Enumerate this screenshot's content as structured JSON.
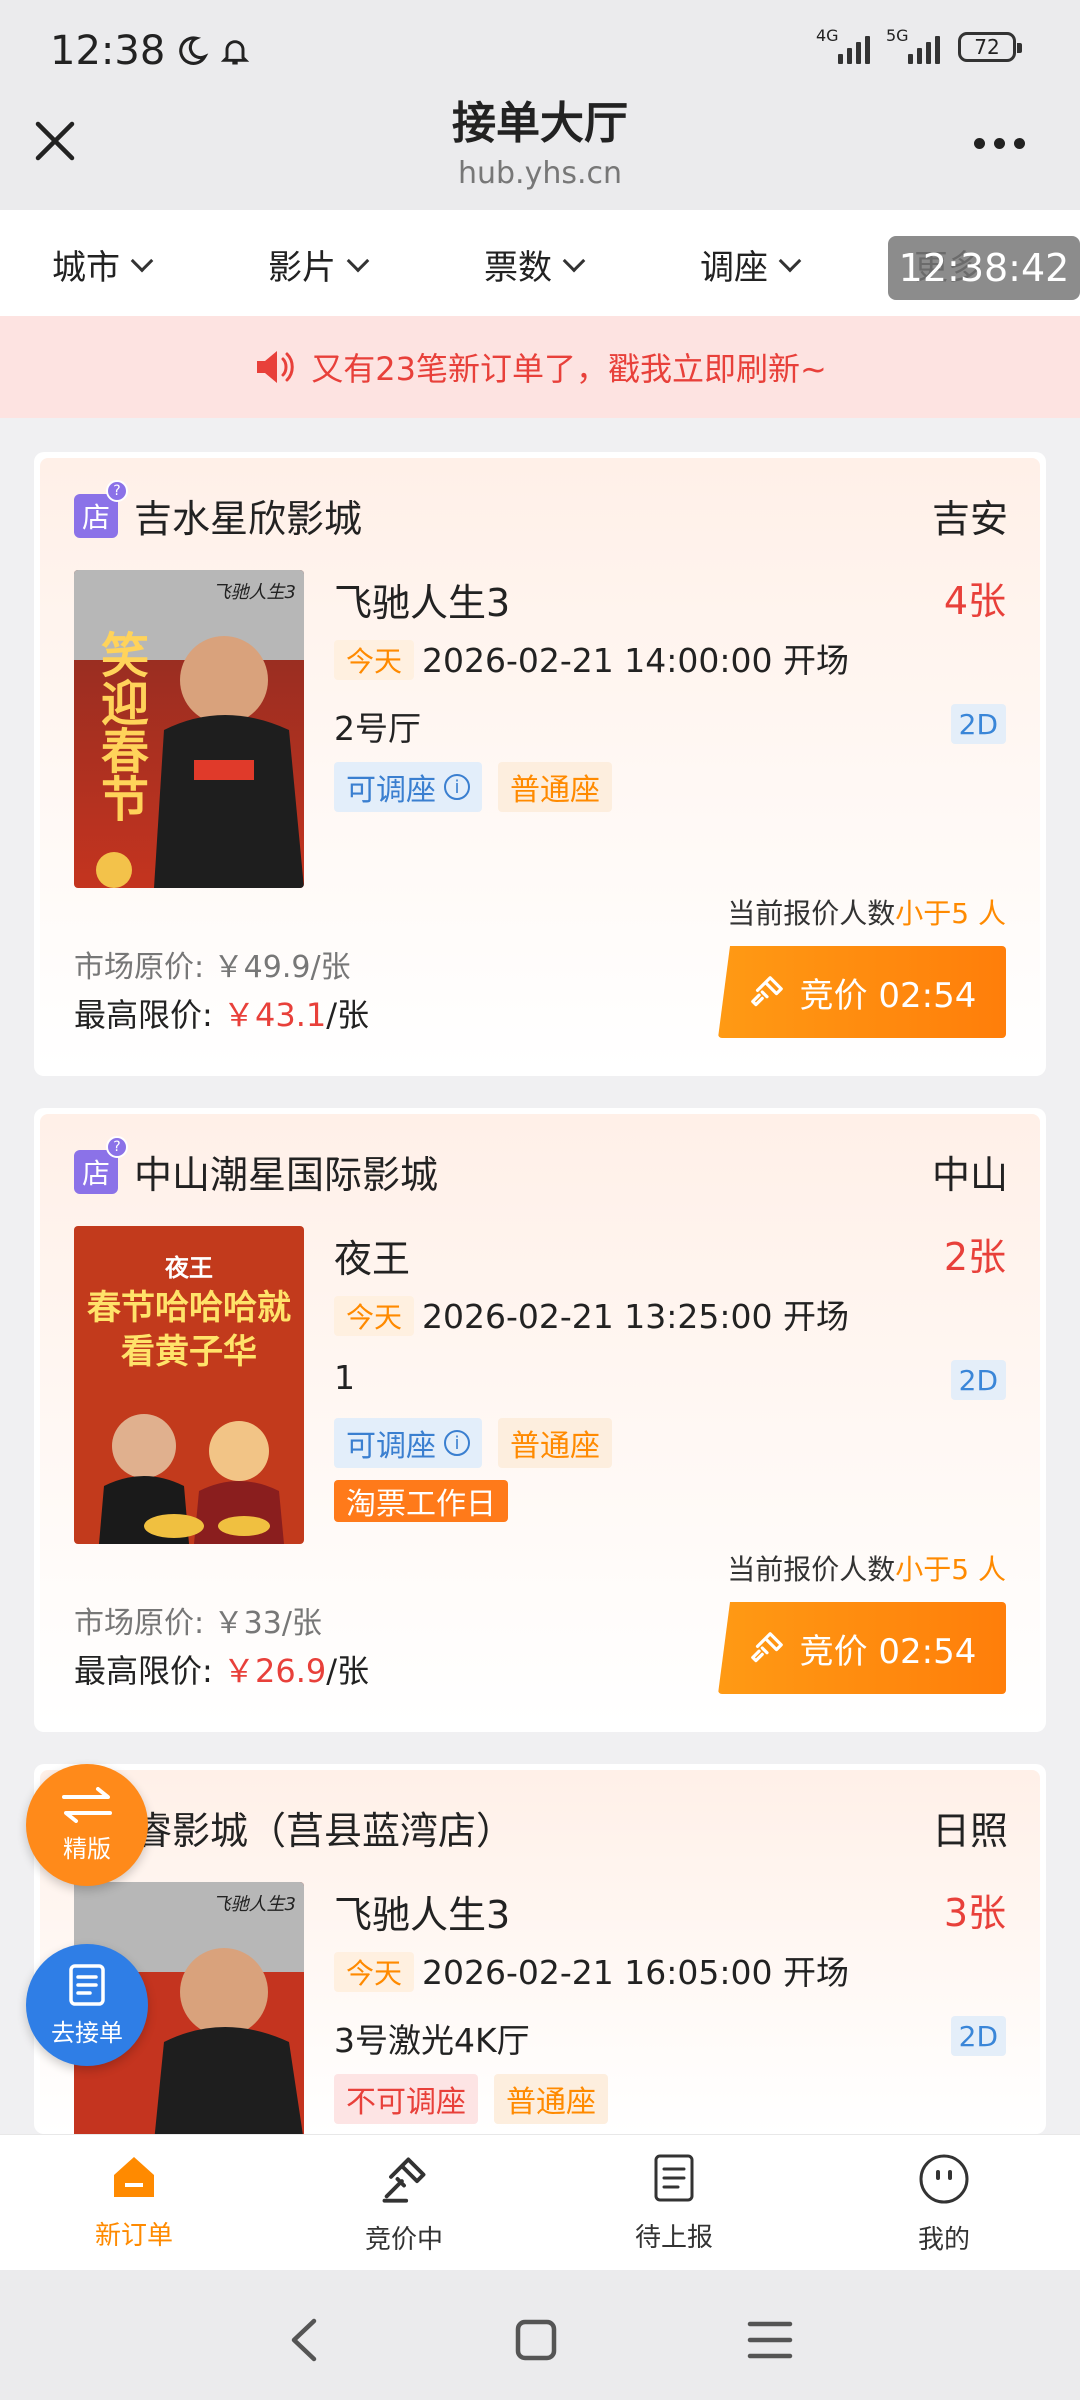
{
  "status_bar": {
    "time": "12:38",
    "net1": "4G",
    "net2": "5G",
    "battery": "72"
  },
  "header": {
    "title": "接单大厅",
    "subtitle": "hub.yhs.cn"
  },
  "filters": {
    "city": "城市",
    "movie": "影片",
    "tickets": "票数",
    "seat": "调座",
    "more": "更多"
  },
  "time_overlay": "12:38:42",
  "notice": "又有23笔新订单了，戳我立即刷新~",
  "orders": [
    {
      "store_badge": "店",
      "cinema": "吉水星欣影城",
      "city": "吉安",
      "poster_text": "笑迎春节",
      "poster_logo": "飞驰人生3",
      "movie": "飞驰人生3",
      "qty": "4张",
      "today": "今天",
      "showtime": "2026-02-21 14:00:00 开场",
      "hall": "2号厅",
      "format": "2D",
      "tags": [
        "可调座",
        "普通座"
      ],
      "bid_count_label": "当前报价人数",
      "bid_count_value": "小于5 人",
      "bid_button": "竞价 02:54",
      "market_price": "市场原价: ￥49.9/张",
      "max_price_label": "最高限价:",
      "max_price": "￥43.1",
      "max_price_unit": "/张"
    },
    {
      "store_badge": "店",
      "cinema": "中山潮星国际影城",
      "city": "中山",
      "poster_text": "春节哈哈哈就看黄子华",
      "poster_logo": "夜王",
      "movie": "夜王",
      "qty": "2张",
      "today": "今天",
      "showtime": "2026-02-21 13:25:00 开场",
      "hall": "1",
      "format": "2D",
      "tags": [
        "可调座",
        "普通座"
      ],
      "extra_tag": "淘票工作日",
      "bid_count_label": "当前报价人数",
      "bid_count_value": "小于5 人",
      "bid_button": "竞价 02:54",
      "market_price": "市场原价: ￥33/张",
      "max_price_label": "最高限价:",
      "max_price": "￥26.9",
      "max_price_unit": "/张"
    },
    {
      "cinema": "博睿影城（莒县蓝湾店）",
      "city": "日照",
      "poster_logo": "飞驰人生3",
      "movie": "飞驰人生3",
      "qty": "3张",
      "today": "今天",
      "showtime": "2026-02-21 16:05:00 开场",
      "hall": "3号激光4K厅",
      "format": "2D",
      "tags": [
        "不可调座",
        "普通座"
      ]
    }
  ],
  "fabs": {
    "version": "精版",
    "take_orders": "去接单"
  },
  "bottom_nav": [
    "新订单",
    "竞价中",
    "待上报",
    "我的"
  ],
  "colors": {
    "accent": "#ff8a00",
    "price_red": "#e8403a",
    "blue": "#2f7ee6",
    "purple": "#8b72e8"
  }
}
